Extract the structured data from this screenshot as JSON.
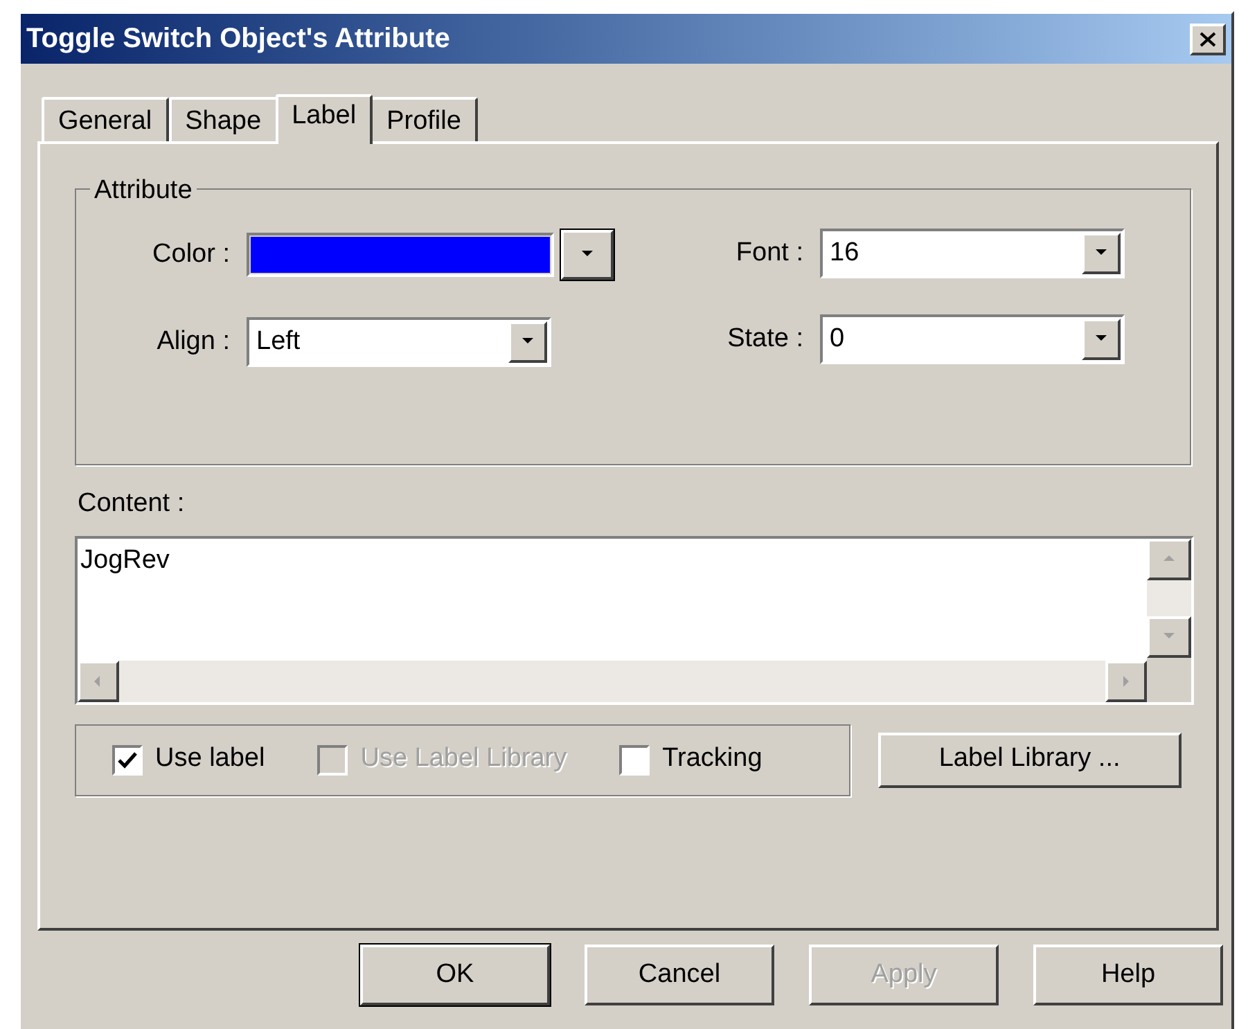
{
  "window": {
    "title": "Toggle Switch Object's Attribute"
  },
  "tabs": [
    {
      "label": "General",
      "selected": false
    },
    {
      "label": "Shape",
      "selected": false
    },
    {
      "label": "Label",
      "selected": true
    },
    {
      "label": "Profile",
      "selected": false
    }
  ],
  "attribute": {
    "title": "Attribute",
    "color": {
      "label": "Color :",
      "color": "#0000ff"
    },
    "align": {
      "label": "Align :",
      "value": "Left"
    },
    "font": {
      "label": "Font :",
      "value": "16"
    },
    "state": {
      "label": "State :",
      "value": "0"
    }
  },
  "content": {
    "label": "Content :",
    "value": "JogRev"
  },
  "options": [
    {
      "label": "Use label",
      "checked": true,
      "disabled": false
    },
    {
      "label": "Use Label Library",
      "checked": false,
      "disabled": true
    },
    {
      "label": "Tracking",
      "checked": false,
      "disabled": false
    }
  ],
  "library_button": "Label Library ...",
  "buttons": [
    {
      "label": "OK",
      "default": true,
      "disabled": false
    },
    {
      "label": "Cancel",
      "default": false,
      "disabled": false
    },
    {
      "label": "Apply",
      "default": false,
      "disabled": true
    },
    {
      "label": "Help",
      "default": false,
      "disabled": false
    }
  ]
}
